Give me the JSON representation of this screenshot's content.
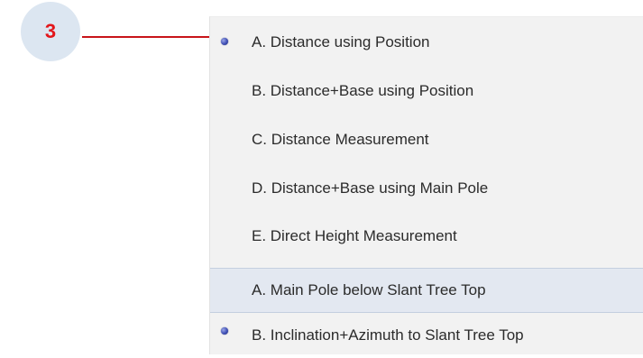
{
  "step": {
    "number": "3",
    "badge_color": "#dce6f1",
    "number_color": "#e3161b",
    "callout_color": "#c8141a"
  },
  "menu": {
    "items": [
      {
        "label": "A. Distance using Position",
        "selected": true,
        "highlighted": false,
        "icon": "radio-bullet-icon"
      },
      {
        "label": "B. Distance+Base using Position",
        "selected": false,
        "highlighted": false
      },
      {
        "label": "C. Distance Measurement",
        "selected": false,
        "highlighted": false
      },
      {
        "label": "D. Distance+Base using Main Pole",
        "selected": false,
        "highlighted": false
      },
      {
        "label": "E. Direct Height Measurement",
        "selected": false,
        "highlighted": false
      },
      {
        "label": "A. Main Pole below Slant Tree Top",
        "selected": false,
        "highlighted": true
      },
      {
        "label": "B. Inclination+Azimuth to Slant Tree Top",
        "selected": true,
        "highlighted": false,
        "icon": "radio-bullet-icon"
      }
    ],
    "background": "#f2f2f2",
    "highlight_color": "#e3e8f1"
  }
}
